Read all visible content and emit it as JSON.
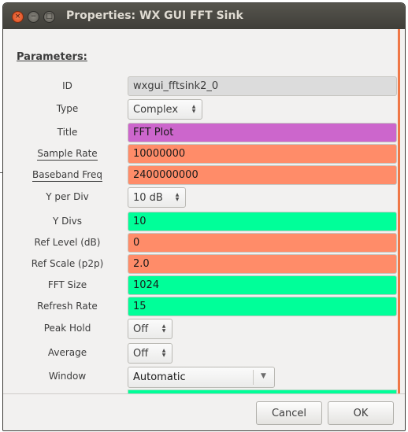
{
  "window": {
    "title": "Properties: WX GUI FFT Sink"
  },
  "window_controls": {
    "close_glyph": "×",
    "minimize_glyph": "−",
    "maximize_glyph": "□"
  },
  "section": {
    "label": "Parameters:"
  },
  "params": {
    "id": {
      "label": "ID",
      "value": "wxgui_fftsink2_0",
      "color": "#dcdcdc"
    },
    "type": {
      "label": "Type",
      "value": "Complex"
    },
    "title": {
      "label": "Title",
      "value": "FFT Plot",
      "color": "#cc66cc"
    },
    "sample_rate": {
      "label": "Sample Rate",
      "value": "10000000",
      "color": "#ff8c69"
    },
    "baseband_freq": {
      "label": "Baseband Freq",
      "value": "2400000000",
      "color": "#ff8c69"
    },
    "y_per_div": {
      "label": "Y per Div",
      "value": "10 dB"
    },
    "y_divs": {
      "label": "Y Divs",
      "value": "10",
      "color": "#00ff99"
    },
    "ref_level": {
      "label": "Ref Level (dB)",
      "value": "0",
      "color": "#ff8c69"
    },
    "ref_scale": {
      "label": "Ref Scale (p2p)",
      "value": "2.0",
      "color": "#ff8c69"
    },
    "fft_size": {
      "label": "FFT Size",
      "value": "1024",
      "color": "#00ff99"
    },
    "refresh_rate": {
      "label": "Refresh Rate",
      "value": "15",
      "color": "#00ff99"
    },
    "peak_hold": {
      "label": "Peak Hold",
      "value": "Off"
    },
    "average": {
      "label": "Average",
      "value": "Off"
    },
    "window_fn": {
      "label": "Window",
      "value": "Automatic"
    }
  },
  "footer": {
    "cancel_label": "Cancel",
    "ok_label": "OK"
  },
  "colors": {
    "scrollbar_accent": "#f07746",
    "titlebar": "#3f3e39"
  }
}
